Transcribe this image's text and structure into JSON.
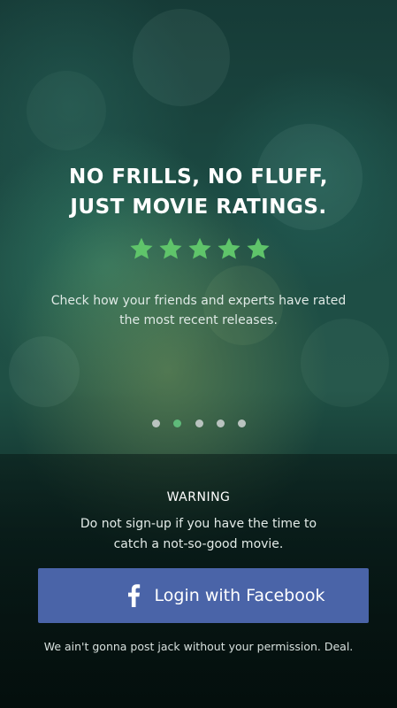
{
  "hero": {
    "title_line1": "NO FRILLS,  NO FLUFF,",
    "title_line2": "JUST MOVIE RATINGS.",
    "rating": {
      "value": 5,
      "max": 5
    },
    "subtitle_line1": "Check how your friends and experts have rated",
    "subtitle_line2": "the most recent releases."
  },
  "pager": {
    "count": 5,
    "active_index": 1
  },
  "warning": {
    "title": "WARNING",
    "line1": "Do not sign-up if you have the time to",
    "line2": "catch a not-so-good movie."
  },
  "login": {
    "label": "Login with Facebook",
    "icon": "facebook-icon"
  },
  "disclaimer": "We ain't gonna post jack without your permission. Deal.",
  "colors": {
    "star": "#5fc46a",
    "active_dot": "#5fba7a",
    "inactive_dot": "#b9c3bf",
    "facebook_button": "#4a64a8"
  }
}
